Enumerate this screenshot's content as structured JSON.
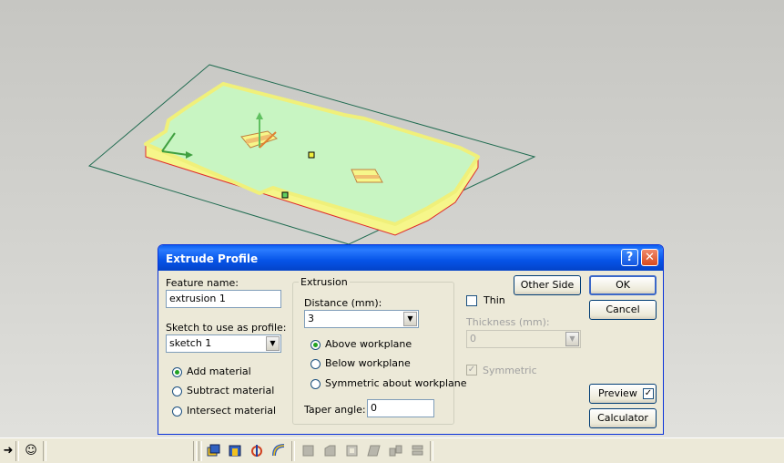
{
  "dialog": {
    "title": "Extrude Profile",
    "feature_name_label": "Feature name:",
    "feature_name_value": "extrusion 1",
    "sketch_label": "Sketch to use as profile:",
    "sketch_value": "sketch 1",
    "material_options": [
      "Add material",
      "Subtract material",
      "Intersect material"
    ],
    "material_selected": "Add material",
    "extrusion_group_label": "Extrusion",
    "distance_label": "Distance (mm):",
    "distance_value": "3",
    "direction_options": [
      "Above workplane",
      "Below workplane",
      "Symmetric about workplane"
    ],
    "direction_selected": "Above workplane",
    "taper_label": "Taper angle:",
    "taper_value": "0",
    "other_side_label": "Other Side",
    "thin_label": "Thin",
    "thin_checked": false,
    "thickness_label": "Thickness (mm):",
    "thickness_value": "0",
    "symmetric_label": "Symmetric",
    "symmetric_checked": true,
    "ok_label": "OK",
    "cancel_label": "Cancel",
    "preview_label": "Preview",
    "preview_checked": true,
    "calculator_label": "Calculator"
  },
  "icons": {
    "help": "help-icon",
    "close": "close-icon",
    "arrow": "arrow-right-icon",
    "smiley": "smiley-icon"
  },
  "colors": {
    "title_bar": "#0654e8",
    "close_button": "#d84a1e",
    "plate_fill": "#c8f5c2",
    "plate_edge": "#f0f07a",
    "outline": "#e02a2a",
    "workplane": "#1f6b50"
  }
}
